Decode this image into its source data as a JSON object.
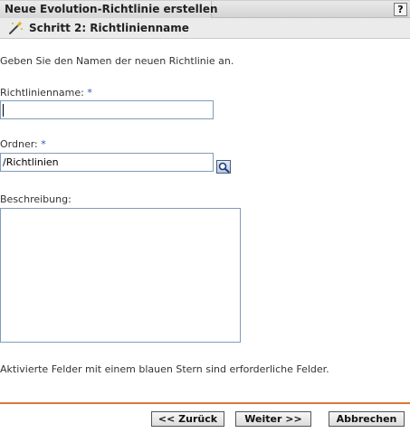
{
  "window": {
    "title": "Neue Evolution-Richtlinie erstellen",
    "help_label": "?"
  },
  "step": {
    "title": "Schritt 2: Richtlinienname",
    "icon": "wand-icon"
  },
  "intro": "Geben Sie den Namen der neuen Richtlinie an.",
  "fields": {
    "name": {
      "label": "Richtlinienname:",
      "required_marker": "*",
      "value": ""
    },
    "folder": {
      "label": "Ordner:",
      "required_marker": "*",
      "value": "/Richtlinien",
      "browse_icon": "magnifier-icon"
    },
    "description": {
      "label": "Beschreibung:",
      "value": ""
    }
  },
  "note": "Aktivierte Felder mit einem blauen Stern sind erforderliche Felder.",
  "buttons": {
    "back": "<< Zurück",
    "next": "Weiter >>",
    "cancel": "Abbrechen"
  },
  "colors": {
    "required": "#2a56b8",
    "divider": "#d9773a",
    "input_border": "#7f9db9"
  }
}
